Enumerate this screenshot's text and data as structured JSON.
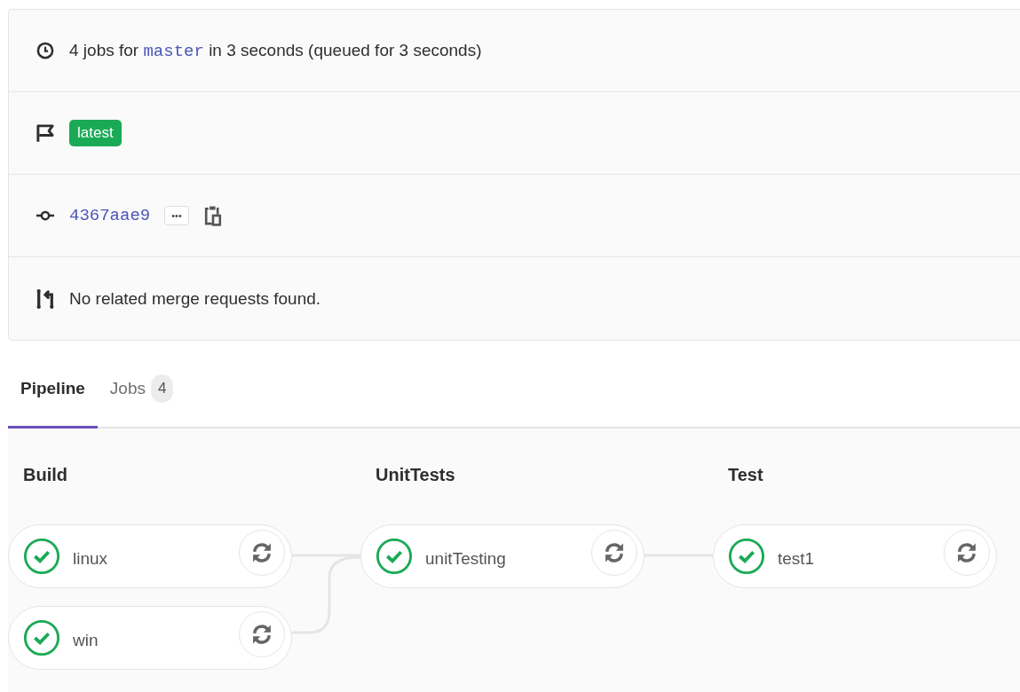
{
  "summary": {
    "prefix": "4 jobs for",
    "branch": "master",
    "suffix": "in 3 seconds (queued for 3 seconds)"
  },
  "tags": [
    {
      "label": "latest"
    }
  ],
  "commit": {
    "sha": "4367aae9",
    "more_label": "•••"
  },
  "merge_requests": {
    "text": "No related merge requests found."
  },
  "tabs": [
    {
      "label": "Pipeline",
      "selected": true
    },
    {
      "label": "Jobs",
      "count": "4",
      "selected": false
    }
  ],
  "stages": [
    {
      "title": "Build",
      "jobs": [
        {
          "name": "linux",
          "kind": "success"
        },
        {
          "name": "win",
          "kind": "success"
        }
      ]
    },
    {
      "title": "UnitTests",
      "jobs": [
        {
          "name": "unitTesting",
          "kind": "success"
        }
      ]
    },
    {
      "title": "Test",
      "jobs": [
        {
          "name": "test1",
          "kind": "success"
        }
      ]
    }
  ]
}
